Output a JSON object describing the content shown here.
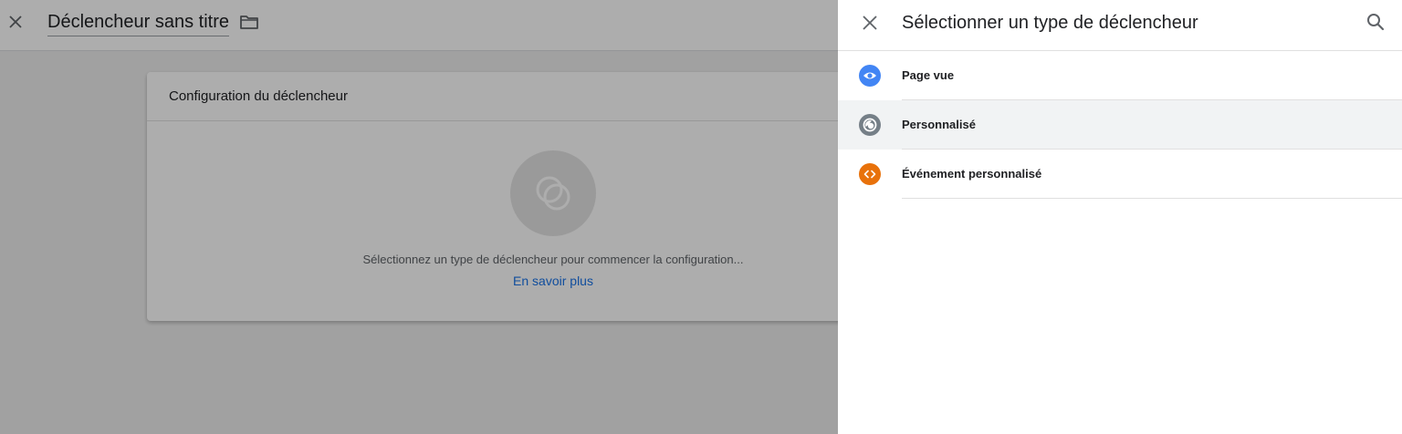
{
  "editor": {
    "title": "Déclencheur sans titre",
    "card": {
      "title": "Configuration du déclencheur",
      "hint": "Sélectionnez un type de déclencheur pour commencer la configuration...",
      "link": "En savoir plus",
      "placeholder_icon": "trigger-placeholder-icon"
    }
  },
  "panel": {
    "title": "Sélectionner un type de déclencheur",
    "items": [
      {
        "label": "Page vue",
        "icon": "eye-icon",
        "color": "#4285f4"
      },
      {
        "label": "Personnalisé",
        "icon": "custom-trigger-icon",
        "color": "#757f87"
      },
      {
        "label": "Événement personnalisé",
        "icon": "code-icon",
        "color": "#e8710a"
      }
    ]
  },
  "colors": {
    "link": "#1a73e8",
    "scrim": "rgba(0,0,0,0.32)",
    "hover_row": "#f1f3f4"
  }
}
